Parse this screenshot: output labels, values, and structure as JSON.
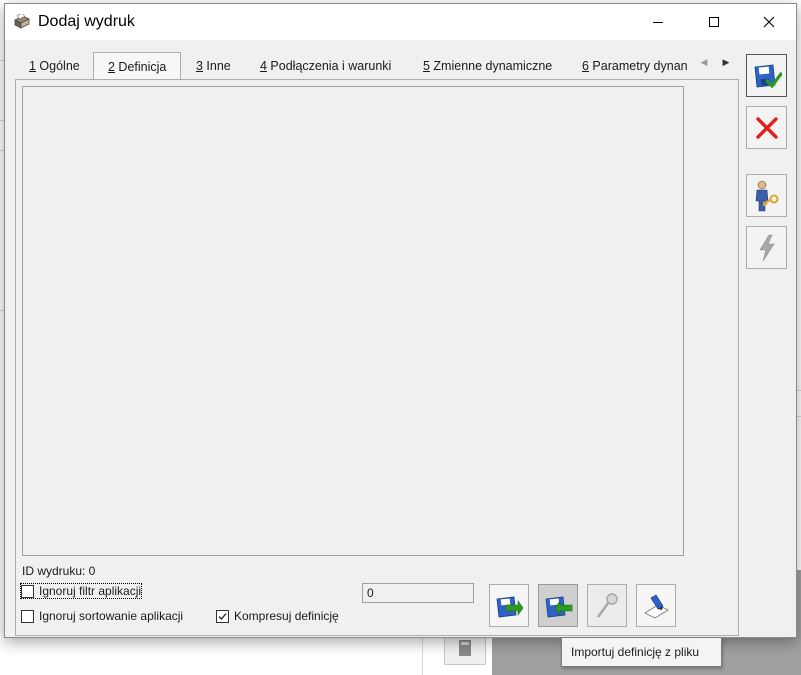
{
  "window": {
    "title": "Dodaj wydruk"
  },
  "tabs": [
    {
      "key": "1",
      "label": " Ogólne",
      "active": false
    },
    {
      "key": "2",
      "label": " Definicja",
      "active": true
    },
    {
      "key": "3",
      "label": " Inne",
      "active": false
    },
    {
      "key": "4",
      "label": " Podłączenia i warunki",
      "active": false
    },
    {
      "key": "5",
      "label": " Zmienne dynamiczne",
      "active": false
    },
    {
      "key": "6",
      "label": " Parametry dynan",
      "active": false
    }
  ],
  "definition": {
    "id_label": "ID wydruku: 0",
    "ignore_filter_label": "Ignoruj filtr aplikacji",
    "ignore_filter_checked": false,
    "ignore_sort_label": "Ignoruj sortowanie aplikacji",
    "ignore_sort_checked": false,
    "compress_label": "Kompresuj definicję",
    "compress_checked": true,
    "number_value": "0"
  },
  "panel_buttons": [
    {
      "icon": "export-disk-icon"
    },
    {
      "icon": "import-disk-icon",
      "pressed": true
    },
    {
      "icon": "magnifier-icon",
      "disabled": true
    },
    {
      "icon": "edit-pen-icon"
    }
  ],
  "tooltip": "Importuj definicję z pliku",
  "toolbar": [
    {
      "icon": "save-check-icon"
    },
    {
      "icon": "cancel-x-icon"
    },
    {
      "icon": "user-key-icon"
    },
    {
      "icon": "lightning-icon",
      "disabled": true
    }
  ],
  "colors": {
    "window_bg": "#f0f0f0",
    "cancel_red": "#e0201b",
    "check_green": "#2c9a1e",
    "disk_blue": "#2f62c8"
  }
}
